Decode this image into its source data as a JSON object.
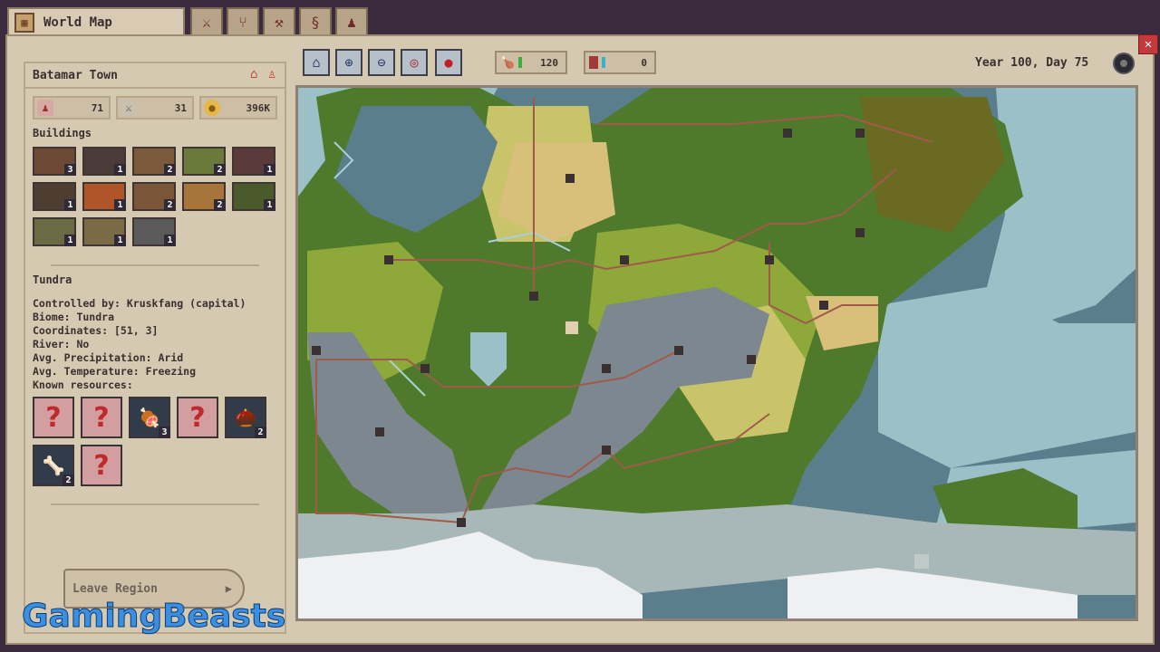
{
  "window": {
    "title": "World Map",
    "close_label": "✕"
  },
  "tabs": [
    {
      "name": "sword-icon",
      "glyph": "⚔"
    },
    {
      "name": "tree-icon",
      "glyph": "⑂"
    },
    {
      "name": "pickaxe-icon",
      "glyph": "⚒"
    },
    {
      "name": "scroll-icon",
      "glyph": "§"
    },
    {
      "name": "people-icon",
      "glyph": "♟"
    }
  ],
  "town": {
    "name": "Batamar Town",
    "population": "71",
    "military": "31",
    "gold": "396K"
  },
  "buildings": {
    "label": "Buildings",
    "counts": [
      "3",
      "1",
      "2",
      "2",
      "1",
      "1",
      "1",
      "2",
      "2",
      "1",
      "1",
      "1",
      "1"
    ],
    "colors": [
      "#6d4a35",
      "#4a3b38",
      "#7a5a3a",
      "#6a7a3a",
      "#5a3a3a",
      "#4e3e32",
      "#b0542a",
      "#7a5538",
      "#a7743a",
      "#4a5a2a",
      "#6a6a45",
      "#7a6a45",
      "#5a5a5a"
    ]
  },
  "region": {
    "name": "Tundra",
    "controlled_by": "Controlled by: Kruskfang (capital)",
    "biome": "Biome: Tundra",
    "coordinates": "Coordinates: [51, 3]",
    "river": "River: No",
    "precipitation": "Avg. Precipitation: Arid",
    "temperature": "Avg. Temperature: Freezing",
    "resources_label": "Known resources:"
  },
  "resources": [
    {
      "known": false,
      "glyph": "?",
      "count": ""
    },
    {
      "known": false,
      "glyph": "?",
      "count": ""
    },
    {
      "known": true,
      "glyph": "🍖",
      "count": "3"
    },
    {
      "known": false,
      "glyph": "?",
      "count": ""
    },
    {
      "known": true,
      "glyph": "🌰",
      "count": "2"
    },
    {
      "known": true,
      "glyph": "🦴",
      "count": "2"
    },
    {
      "known": false,
      "glyph": "?",
      "count": ""
    }
  ],
  "leave_button": "Leave Region",
  "toolbar": {
    "tools": [
      {
        "name": "home-view-icon",
        "glyph": "⌂"
      },
      {
        "name": "zoom-in-icon",
        "glyph": "⊕"
      },
      {
        "name": "zoom-out-icon",
        "glyph": "⊖"
      },
      {
        "name": "target-icon",
        "glyph": "◎"
      },
      {
        "name": "map-pin-icon",
        "glyph": "●"
      }
    ],
    "food": "120",
    "influence": "0"
  },
  "date": "Year 100, Day 75",
  "watermark": "GamingBeasts",
  "colors": {
    "water": "#5b7e8c",
    "shallow": "#9bc0c8",
    "forest": "#4f7a2c",
    "plains": "#8fa83a",
    "yellow": "#c9c46a",
    "sand": "#d8c07a",
    "rock": "#7d8790",
    "swamp": "#6a6a22",
    "tundra": "#a8b8b8",
    "snow": "#eef0f2",
    "road": "#a05a4a",
    "river": "#a8d0da"
  }
}
